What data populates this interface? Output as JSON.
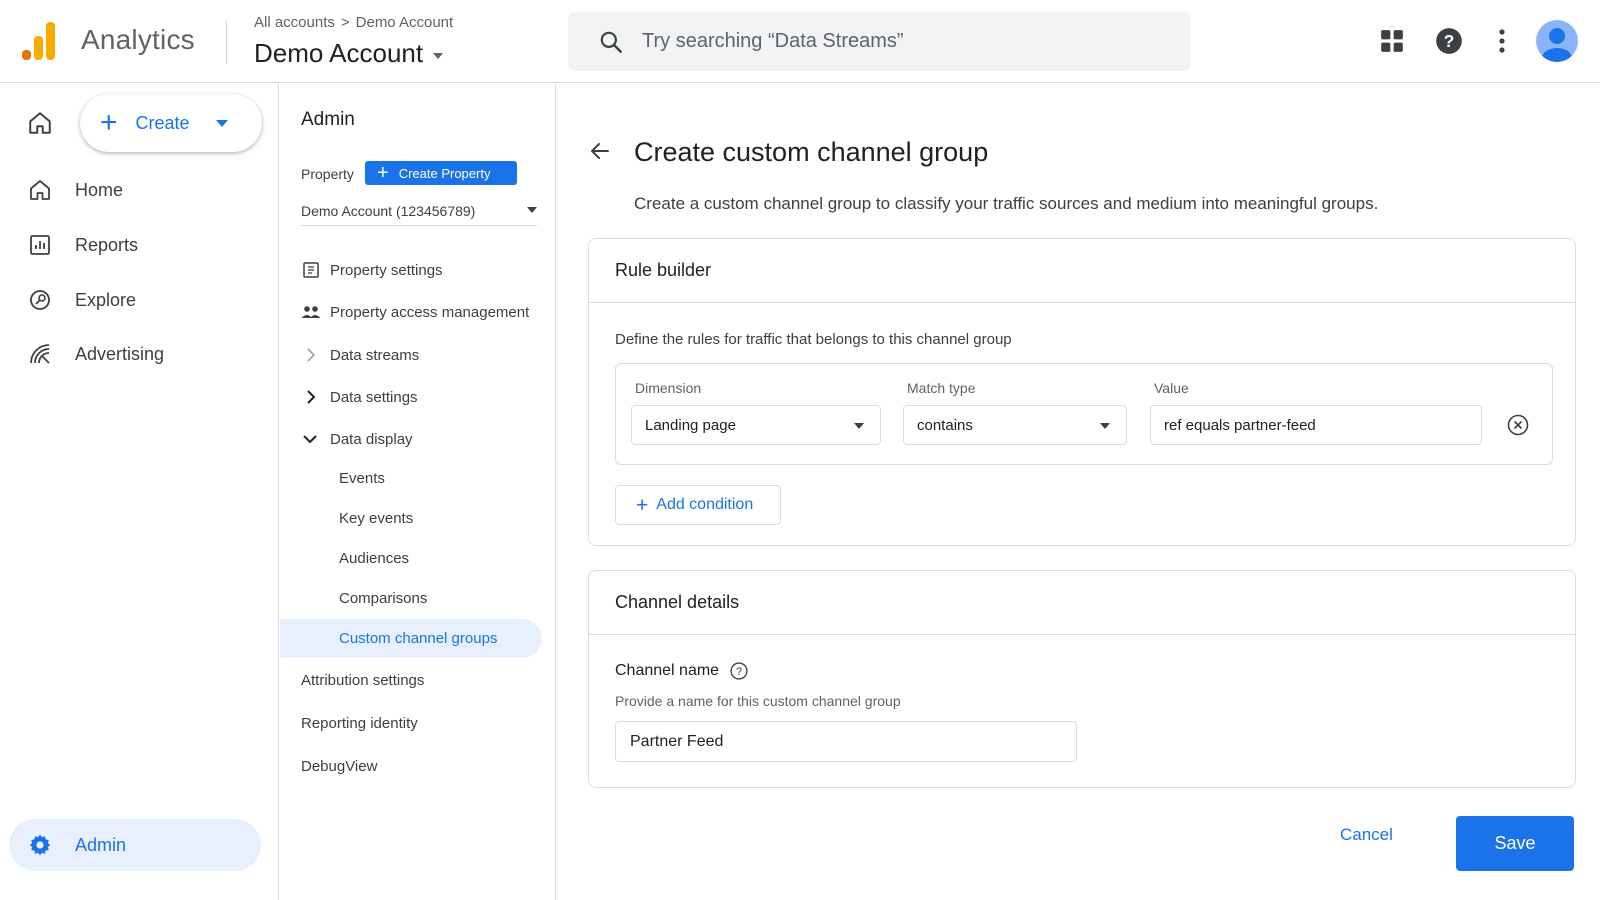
{
  "app": {
    "name": "Analytics",
    "accent": "#1a73e8",
    "logo_colors": [
      "#f9ab00",
      "#e37400"
    ]
  },
  "header": {
    "breadcrumb": [
      "All accounts",
      "Demo Account"
    ],
    "account_title": "Demo Account",
    "search_placeholder": "Try searching “Data Streams”",
    "icons": [
      "search-icon",
      "apps-grid-icon",
      "help-icon",
      "more-vert-icon",
      "account-avatar"
    ]
  },
  "leftnav": {
    "create_label": "Create",
    "items": [
      {
        "label": "Home",
        "icon": "home-icon"
      },
      {
        "label": "Reports",
        "icon": "reports-icon"
      },
      {
        "label": "Explore",
        "icon": "explore-icon"
      },
      {
        "label": "Advertising",
        "icon": "advertising-icon"
      }
    ],
    "admin_label": "Admin"
  },
  "admin": {
    "title": "Admin",
    "property_label": "Property",
    "create_property_label": "Create Property",
    "property_select": "Demo Account (123456789)",
    "items": [
      {
        "label": "Property settings",
        "icon": "property-settings-icon"
      },
      {
        "label": "Property access management",
        "icon": "people-icon"
      },
      {
        "label": "Data streams",
        "icon": "chevron-right-icon"
      },
      {
        "label": "Data settings",
        "icon": "chevron-right-icon"
      },
      {
        "label": "Data display",
        "icon": "chevron-down-icon"
      }
    ],
    "subitems": [
      "Events",
      "Key events",
      "Audiences",
      "Comparisons",
      "Custom channel groups"
    ],
    "after_items": [
      "Attribution settings",
      "Reporting identity",
      "DebugView"
    ]
  },
  "main": {
    "title": "Create custom channel group",
    "description": "Create a custom channel group to classify your traffic sources and medium into meaningful groups.",
    "rule_builder": {
      "title": "Rule builder",
      "description": "Define the rules for traffic that belongs to this channel group",
      "dimension_label": "Dimension",
      "dimension_value": "Landing page",
      "match_label": "Match type",
      "match_value": "contains",
      "value_label": "Value",
      "value_value": "ref equals partner-feed",
      "add_condition_label": "Add condition"
    },
    "channel_details": {
      "title": "Channel details",
      "name_label": "Channel name",
      "name_hint": "Provide a name for this custom channel group",
      "name_value": "Partner Feed"
    },
    "cancel_label": "Cancel",
    "save_label": "Save"
  }
}
